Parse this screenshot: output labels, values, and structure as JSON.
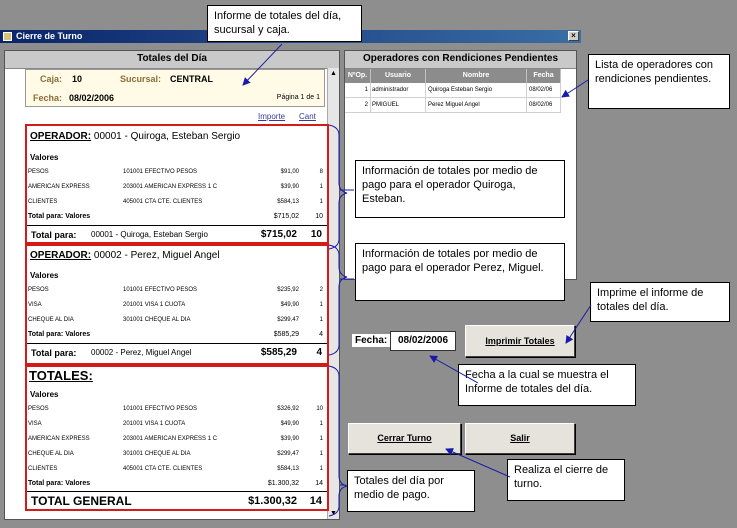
{
  "window": {
    "title": "Cierre de Turno",
    "close_glyph": "×"
  },
  "left_panel": {
    "header": "Totales del Día",
    "caja_label": "Caja:",
    "caja_value": "10",
    "sucursal_label": "Sucursal:",
    "sucursal_value": "CENTRAL",
    "fecha_label": "Fecha:",
    "fecha_value": "08/02/2006",
    "page_text": "Página 1 de 1",
    "col_importe": "Importe",
    "col_cant": "Cant",
    "operators": [
      {
        "label": "OPERADOR:",
        "name": "00001 - Quiroga, Esteban Sergio",
        "section": "Valores",
        "rows": [
          {
            "medio": "PESOS",
            "desc": "101001 EFECTIVO PESOS",
            "importe": "$91,00",
            "cant": "8"
          },
          {
            "medio": "AMERICAN EXPRESS",
            "desc": "203001 AMERICAN EXPRESS 1 C",
            "importe": "$39,90",
            "cant": "1"
          },
          {
            "medio": "CLIENTES",
            "desc": "405001 CTA CTE. CLIENTES",
            "importe": "$584,13",
            "cant": "1"
          }
        ],
        "subtotal_label": "Total para:   Valores",
        "subtotal_importe": "$715,02",
        "subtotal_cant": "10",
        "total_label": "Total para:",
        "total_name": "00001 - Quiroga, Esteban Sergio",
        "total_importe": "$715,02",
        "total_cant": "10"
      },
      {
        "label": "OPERADOR:",
        "name": "00002 - Perez, Miguel Angel",
        "section": "Valores",
        "rows": [
          {
            "medio": "PESOS",
            "desc": "101001 EFECTIVO PESOS",
            "importe": "$235,92",
            "cant": "2"
          },
          {
            "medio": "VISA",
            "desc": "201001 VISA 1 CUOTA",
            "importe": "$49,90",
            "cant": "1"
          },
          {
            "medio": "CHEQUE AL DIA",
            "desc": "301001 CHEQUE AL DIA",
            "importe": "$299,47",
            "cant": "1"
          }
        ],
        "subtotal_label": "Total para:   Valores",
        "subtotal_importe": "$585,29",
        "subtotal_cant": "4",
        "total_label": "Total para:",
        "total_name": "00002 - Perez, Miguel Angel",
        "total_importe": "$585,29",
        "total_cant": "4"
      }
    ],
    "totales": {
      "title": "TOTALES:",
      "section": "Valores",
      "rows": [
        {
          "medio": "PESOS",
          "desc": "101001 EFECTIVO PESOS",
          "importe": "$326,92",
          "cant": "10"
        },
        {
          "medio": "VISA",
          "desc": "201001 VISA 1 CUOTA",
          "importe": "$49,90",
          "cant": "1"
        },
        {
          "medio": "AMERICAN EXPRESS",
          "desc": "203001 AMERICAN EXPRESS 1 C",
          "importe": "$39,90",
          "cant": "1"
        },
        {
          "medio": "CHEQUE AL DIA",
          "desc": "301001 CHEQUE AL DIA",
          "importe": "$299,47",
          "cant": "1"
        },
        {
          "medio": "CLIENTES",
          "desc": "405001 CTA CTE. CLIENTES",
          "importe": "$584,13",
          "cant": "1"
        }
      ],
      "subtotal_label": "Total para:   Valores",
      "subtotal_importe": "$1.300,32",
      "subtotal_cant": "14",
      "general_label": "TOTAL GENERAL",
      "general_importe": "$1.300,32",
      "general_cant": "14"
    }
  },
  "right_panel": {
    "header": "Operadores con Rendiciones Pendientes",
    "columns": [
      "NºOp.",
      "Usuario",
      "Nombre",
      "Fecha"
    ],
    "rows": [
      {
        "num": "1",
        "usuario": "administrador",
        "nombre": "Quiroga Esteban Sergio",
        "fecha": "08/02/06"
      },
      {
        "num": "2",
        "usuario": "PMIGUEL",
        "nombre": "Perez Miguel Angel",
        "fecha": "08/02/06"
      }
    ]
  },
  "controls": {
    "fecha_label": "Fecha:",
    "fecha_value": "08/02/2006",
    "imprimir_label": "Imprimir Totales",
    "cerrar_label": "Cerrar Turno",
    "salir_label": "Salir"
  },
  "callouts": {
    "informe": "Informe de totales del día, sucursal y caja.",
    "lista": "Lista de operadores con rendiciones pendientes.",
    "op1": "Información de totales por medio de pago para el operador Quiroga, Esteban.",
    "op2": "Información de totales por medio de pago para el operador Perez, Miguel.",
    "imprime": "Imprime el informe de totales del día.",
    "fecha": "Fecha a la cual se muestra el Informe de totales del día.",
    "cierre": "Realiza el cierre de turno.",
    "totales": "Totales del día por medio de pago."
  },
  "colors": {
    "titlebar": "#0a246a",
    "highlight_box": "#d51a1a",
    "bracket": "#1a1aa8",
    "grid_header": "#8c8c8c"
  },
  "icons": [
    "window-app-icon",
    "close-icon",
    "scroll-up-icon",
    "scroll-down-icon"
  ]
}
